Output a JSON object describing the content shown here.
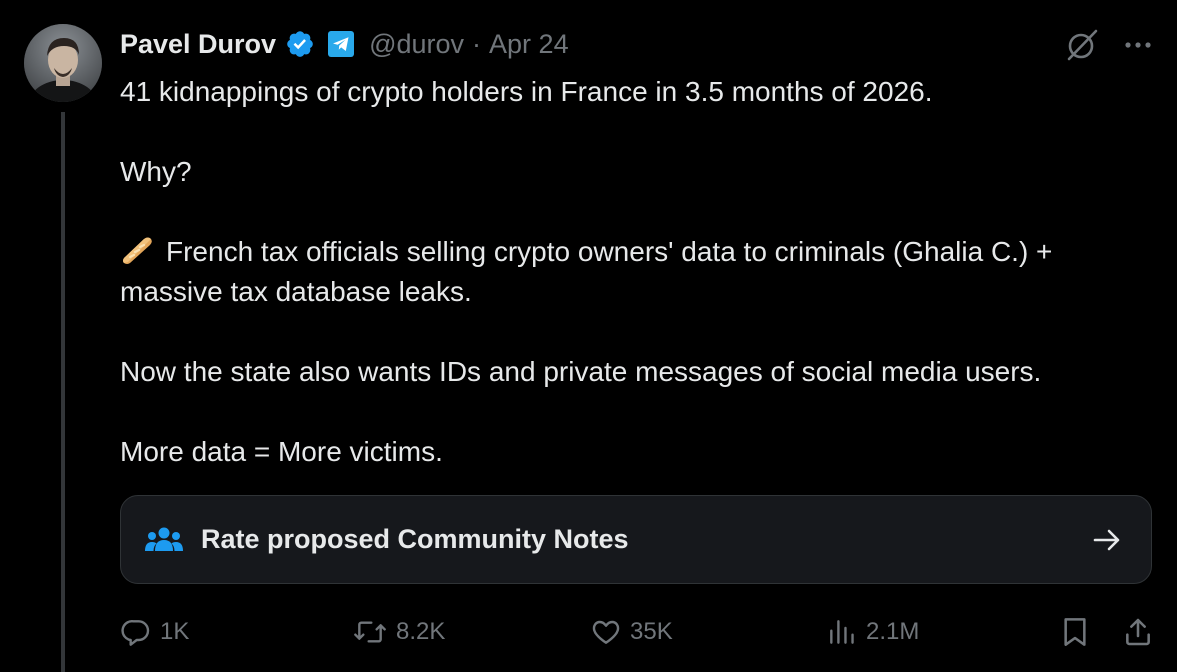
{
  "author": {
    "name": "Pavel Durov",
    "handle": "@durov",
    "separator": "·",
    "date": "Apr 24"
  },
  "icons": {
    "verified": "verified-badge-icon",
    "affiliate": "telegram-affiliate-icon",
    "grok": "grok-icon",
    "more": "more-options-icon",
    "emoji": "baguette-emoji"
  },
  "tweet": {
    "paragraphs": [
      "41 kidnappings of crypto holders in France in 3.5 months of 2026.",
      "Why?",
      "French tax officials selling crypto owners' data to criminals (Ghalia C.) + massive tax database leaks.",
      "Now the state also wants IDs and private messages of social media users.",
      "More data = More victims."
    ]
  },
  "community_note": {
    "label": "Rate proposed Community Notes"
  },
  "actions": {
    "replies": "1K",
    "reposts": "8.2K",
    "likes": "35K",
    "views": "2.1M"
  },
  "colors": {
    "background": "#000000",
    "text": "#e7e9ea",
    "muted": "#71767b",
    "verified_blue": "#1d9bf0",
    "telegram_blue": "#29a9eb",
    "note_bg": "#16181c",
    "border": "#2f3336"
  }
}
